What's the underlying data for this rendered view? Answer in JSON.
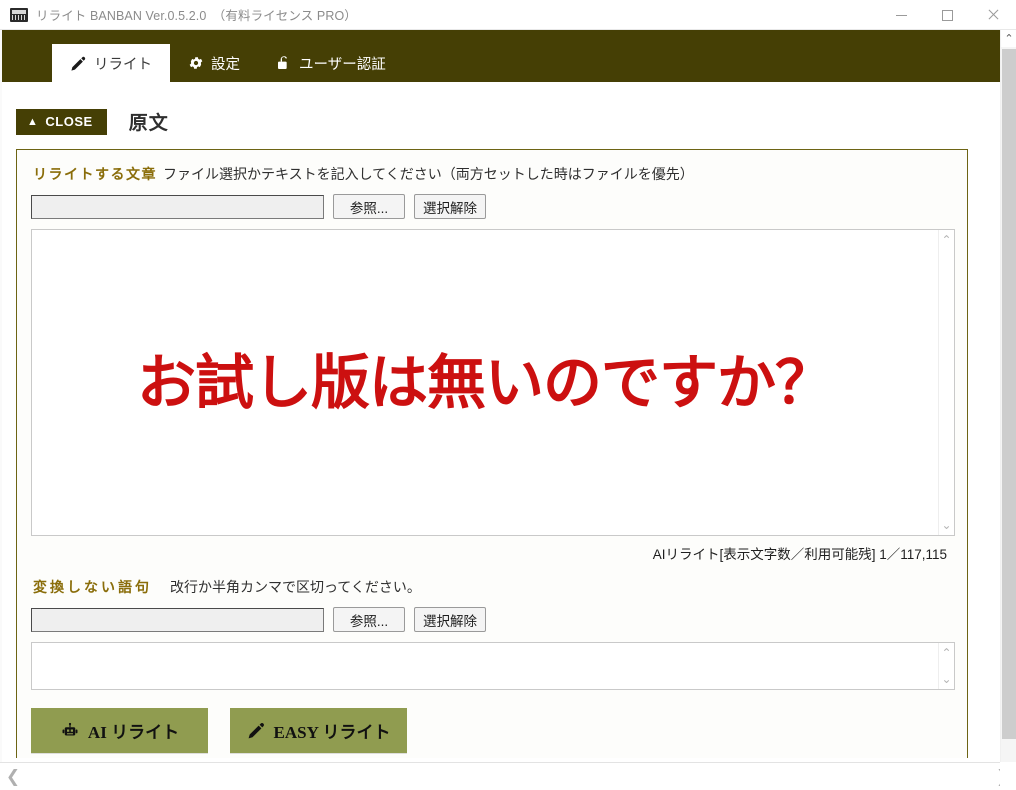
{
  "window": {
    "title": "リライト BANBAN Ver.0.5.2.0　（有料ライセンス PRO）",
    "icon": "app-icon",
    "minimize_label": "minimize",
    "maximize_label": "maximize",
    "close_label": "close"
  },
  "tabs": [
    {
      "label": "リライト",
      "icon": "pen-icon",
      "active": true
    },
    {
      "label": "設定",
      "icon": "gear-icon",
      "active": false
    },
    {
      "label": "ユーザー認証",
      "icon": "lock-icon",
      "active": false
    }
  ],
  "header": {
    "close_button": "CLOSE",
    "close_chevron": "︿",
    "page_title": "原文"
  },
  "source_section": {
    "gold_label": "リライトする文章",
    "hint": "ファイル選択かテキストを記入してください（両方セットした時はファイルを優先）",
    "file_path_value": "",
    "file_path_placeholder": "",
    "browse_button": "参照...",
    "clear_button": "選択解除",
    "textarea_text": "お試し版は無いのですか？",
    "counter": "AIリライト[表示文字数／利用可能残] 1／117,115"
  },
  "exclude_section": {
    "gold_label": "変換しない語句",
    "hint": "改行か半角カンマで区切ってください。",
    "file_path_value": "",
    "file_path_placeholder": "",
    "browse_button": "参照...",
    "clear_button": "選択解除",
    "textarea_text": ""
  },
  "actions": {
    "ai_rewrite": "AI リライト",
    "ai_rewrite_icon": "robot-icon",
    "easy_rewrite": "EASY リライト",
    "easy_rewrite_icon": "pen-icon"
  },
  "scrollbars": {
    "up_arrow": "⌃",
    "down_arrow": "⌄",
    "left_arrow": "❮",
    "right_arrow": "❯"
  },
  "colors": {
    "olive_bar": "#453f05",
    "gold_label": "#8a6d0a",
    "button_green": "#909c50",
    "red_text": "#cc1010",
    "panel_border": "#6d6414"
  }
}
